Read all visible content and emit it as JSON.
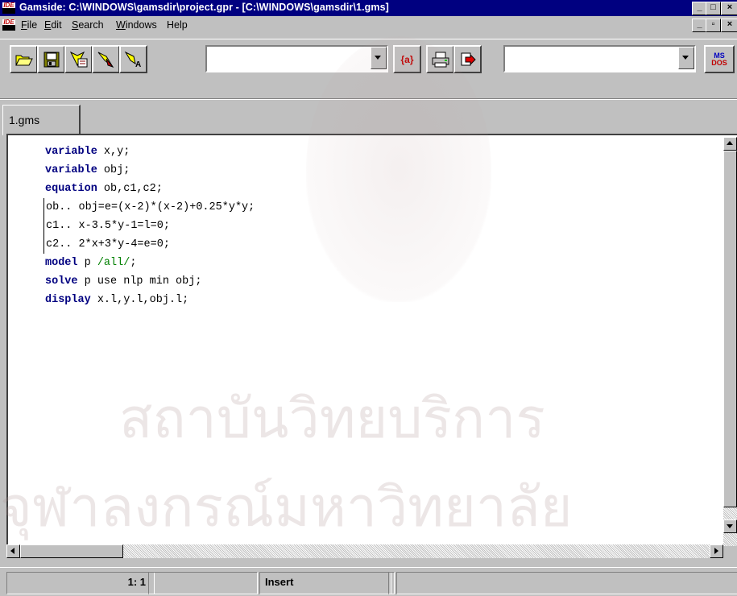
{
  "window": {
    "title": "Gamside: C:\\WINDOWS\\gamsdir\\project.gpr - [C:\\WINDOWS\\gamsdir\\1.gms]",
    "app_icon": "IDE",
    "controls": [
      "_",
      "□",
      "×"
    ],
    "mdi_controls": [
      "_",
      "▫",
      "×"
    ]
  },
  "menu": {
    "items": [
      {
        "label": "File",
        "accel": "F",
        "rest": "ile"
      },
      {
        "label": "Edit",
        "accel": "E",
        "rest": "dit"
      },
      {
        "label": "Search",
        "accel": "S",
        "rest": "earch"
      },
      {
        "label": "Windows",
        "accel": "W",
        "rest": "indows"
      },
      {
        "label": "Help",
        "accel": "",
        "rest": "Help"
      }
    ]
  },
  "toolbar": {
    "combo1_value": "",
    "model_button_label": "{a}",
    "combo2_value": "",
    "msdos_label_top": "MS",
    "msdos_label_bottom": "DOS"
  },
  "tabs": [
    {
      "label": "1.gms",
      "active": true
    }
  ],
  "editor": {
    "lines": [
      [
        {
          "t": "variable",
          "c": "kw"
        },
        {
          "t": " x,y;",
          "c": ""
        }
      ],
      [
        {
          "t": "variable",
          "c": "kw"
        },
        {
          "t": " obj;",
          "c": ""
        }
      ],
      [
        {
          "t": "equation",
          "c": "kw"
        },
        {
          "t": " ob,c1,c2;",
          "c": ""
        }
      ],
      [
        {
          "t": "ob.. obj=e=(x-2)*(x-2)+0.25*y*y;",
          "c": ""
        }
      ],
      [
        {
          "t": "c1.. x-3.5*y-1=l=0;",
          "c": ""
        }
      ],
      [
        {
          "t": "c2.. 2*x+3*y-4=e=0;",
          "c": ""
        }
      ],
      [
        {
          "t": "model",
          "c": "kw"
        },
        {
          "t": " p ",
          "c": ""
        },
        {
          "t": "/all/",
          "c": "set"
        },
        {
          "t": ";",
          "c": ""
        }
      ],
      [
        {
          "t": "solve",
          "c": "kw"
        },
        {
          "t": " p use nlp min obj;",
          "c": ""
        }
      ],
      [
        {
          "t": "display",
          "c": "kw"
        },
        {
          "t": " x.l,y.l,obj.l;",
          "c": ""
        }
      ]
    ]
  },
  "status": {
    "position": "1: 1",
    "mode": "Insert",
    "message": ""
  },
  "watermark": {
    "line1": "สถาบันวิทยบริการ",
    "line2": "จุฬาลงกรณ์มหาวิทยาลัย"
  },
  "colors": {
    "titlebar": "#000080",
    "keyword": "#000080",
    "set_literal": "#008000",
    "face": "#c0c0c0"
  }
}
